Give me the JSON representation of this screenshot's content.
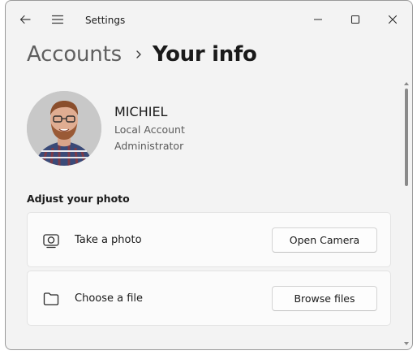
{
  "window": {
    "title": "Settings"
  },
  "breadcrumb": {
    "parent": "Accounts",
    "current": "Your info"
  },
  "profile": {
    "name": "MICHIEL",
    "account_type": "Local Account",
    "role": "Administrator"
  },
  "adjust_photo": {
    "heading": "Adjust your photo",
    "items": [
      {
        "icon": "camera-icon",
        "label": "Take a photo",
        "button": "Open Camera"
      },
      {
        "icon": "folder-icon",
        "label": "Choose a file",
        "button": "Browse files"
      }
    ]
  },
  "colors": {
    "window_bg": "#f3f3f3",
    "card_bg": "#fbfbfb",
    "text_primary": "#1a1a1a",
    "text_secondary": "#5a5a5a"
  }
}
